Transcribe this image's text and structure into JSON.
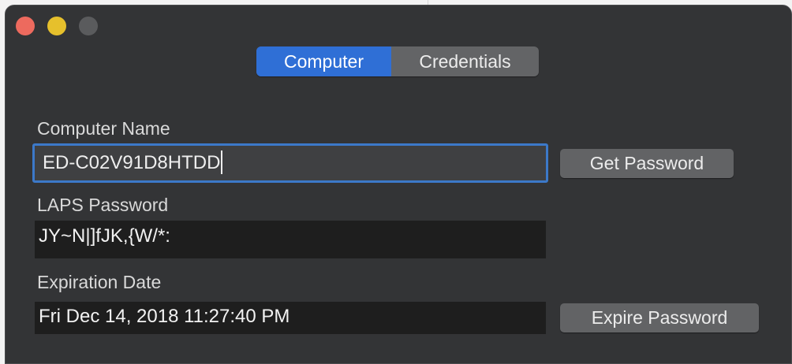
{
  "window": {
    "traffic_lights": [
      "close",
      "minimize",
      "zoom"
    ]
  },
  "tabs": [
    {
      "label": "Computer",
      "active": true
    },
    {
      "label": "Credentials",
      "active": false
    }
  ],
  "computer_name": {
    "label": "Computer Name",
    "value": "ED-C02V91D8HTDD"
  },
  "laps_password": {
    "label": "LAPS Password",
    "value": "JY~N|]fJK,{W/*:"
  },
  "expiration": {
    "label": "Expiration Date",
    "value": "Fri Dec 14, 2018 11:27:40 PM"
  },
  "buttons": {
    "get_password": "Get Password",
    "expire_password": "Expire Password"
  },
  "colors": {
    "window_bg": "#333436",
    "accent": "#2f6fd6",
    "focus_ring": "#3c79c9",
    "close": "#ed6a5e",
    "minimize": "#e6c02c"
  }
}
